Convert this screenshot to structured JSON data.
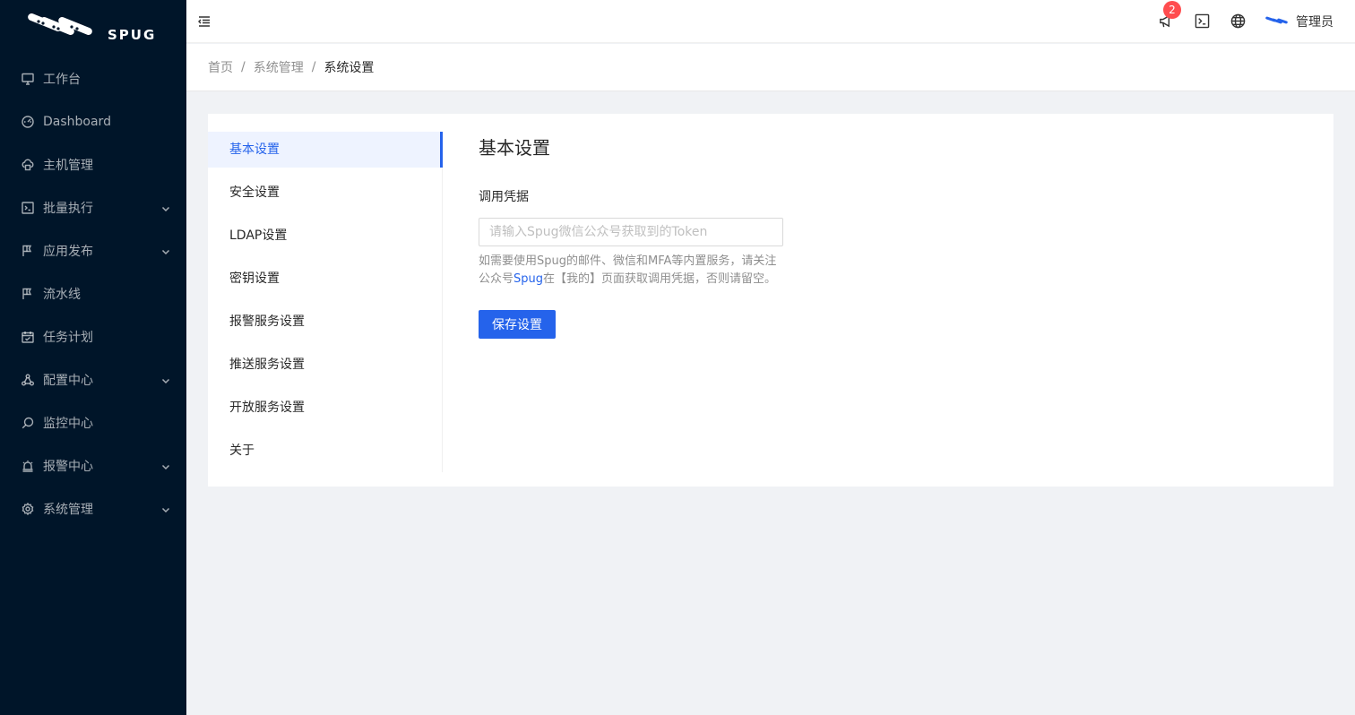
{
  "brand": {
    "logo_text": "SPUG"
  },
  "sidebar": {
    "items": [
      {
        "label": "工作台",
        "icon": "desktop-icon",
        "has_submenu": false
      },
      {
        "label": "Dashboard",
        "icon": "dashboard-icon",
        "has_submenu": false
      },
      {
        "label": "主机管理",
        "icon": "cloud-server-icon",
        "has_submenu": false
      },
      {
        "label": "批量执行",
        "icon": "code-icon",
        "has_submenu": true
      },
      {
        "label": "应用发布",
        "icon": "flag-icon",
        "has_submenu": true
      },
      {
        "label": "流水线",
        "icon": "flag-icon",
        "has_submenu": false
      },
      {
        "label": "任务计划",
        "icon": "schedule-icon",
        "has_submenu": false
      },
      {
        "label": "配置中心",
        "icon": "deployment-unit-icon",
        "has_submenu": true
      },
      {
        "label": "监控中心",
        "icon": "monitor-icon",
        "has_submenu": false
      },
      {
        "label": "报警中心",
        "icon": "alert-icon",
        "has_submenu": true
      },
      {
        "label": "系统管理",
        "icon": "setting-icon",
        "has_submenu": true
      }
    ]
  },
  "header": {
    "notification_count": "2",
    "user_name": "管理员"
  },
  "breadcrumb": [
    "首页",
    "系统管理",
    "系统设置"
  ],
  "settings_menu": {
    "items": [
      "基本设置",
      "安全设置",
      "LDAP设置",
      "密钥设置",
      "报警服务设置",
      "推送服务设置",
      "开放服务设置",
      "关于"
    ],
    "active_index": 0
  },
  "basic_settings": {
    "title": "基本设置",
    "field_label": "调用凭据",
    "input_placeholder": "请输入Spug微信公众号获取到的Token",
    "input_value": "",
    "help_text_1": "如需要使用Spug的邮件、微信和MFA等内置服务，请关注公众号",
    "help_link": "Spug",
    "help_text_2": "在【我的】页面获取调用凭据，否则请留空。",
    "save_label": "保存设置"
  },
  "colors": {
    "sidebar_bg": "#001529",
    "primary": "#2563eb",
    "badge": "#ff4d4f"
  }
}
